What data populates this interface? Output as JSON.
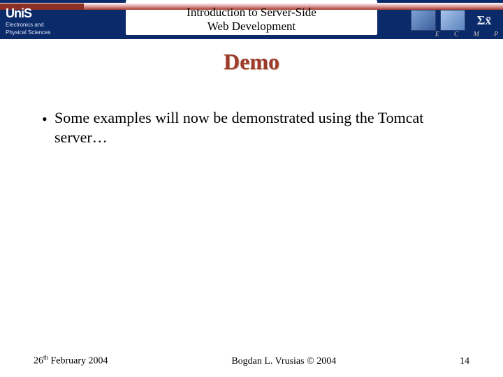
{
  "header": {
    "org_short": "UniS",
    "org_dept_line1": "Electronics and",
    "org_dept_line2": "Physical Sciences",
    "title_line1": "Introduction to Server-Side",
    "title_line2": "Web Development",
    "right_letters": [
      "E",
      "C",
      "M",
      "P"
    ],
    "sigma": "Σx̄"
  },
  "slide": {
    "title": "Demo",
    "bullets": [
      "Some examples will now be demonstrated using the Tomcat server…"
    ]
  },
  "footer": {
    "date_day": "26",
    "date_suffix": "th",
    "date_rest": " February 2004",
    "author": "Bogdan L. Vrusias © 2004",
    "page": "14"
  }
}
